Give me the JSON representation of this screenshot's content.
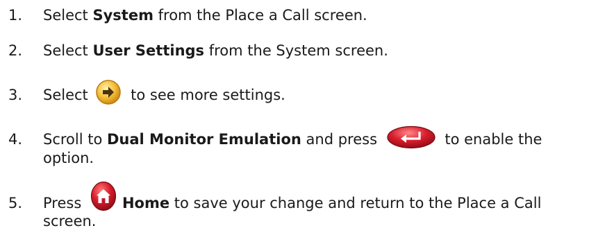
{
  "steps": [
    {
      "num": "1.",
      "pre": "Select ",
      "bold": "System",
      "post": " from the Place a Call screen."
    },
    {
      "num": "2.",
      "pre": "Select ",
      "bold": "User Settings",
      "post": " from the System screen."
    },
    {
      "num": "3.",
      "pre": "Select ",
      "post": " to see more settings.",
      "icon": "right-arrow-icon"
    },
    {
      "num": "4.",
      "pre": "Scroll to ",
      "bold": "Dual Monitor Emulation",
      "mid": " and press ",
      "post": " to enable the",
      "line2": "option.",
      "icon": "enter-return-icon"
    },
    {
      "num": "5.",
      "pre": "Press ",
      "bold": "Home",
      "post": " to save your change and return to the Place a Call",
      "line2": "screen.",
      "icon": "home-icon"
    }
  ],
  "colors": {
    "text": "#1a1a1a",
    "arrow_icon": "#f0b030",
    "enter_icon": "#c8102e",
    "home_icon": "#c8102e"
  }
}
